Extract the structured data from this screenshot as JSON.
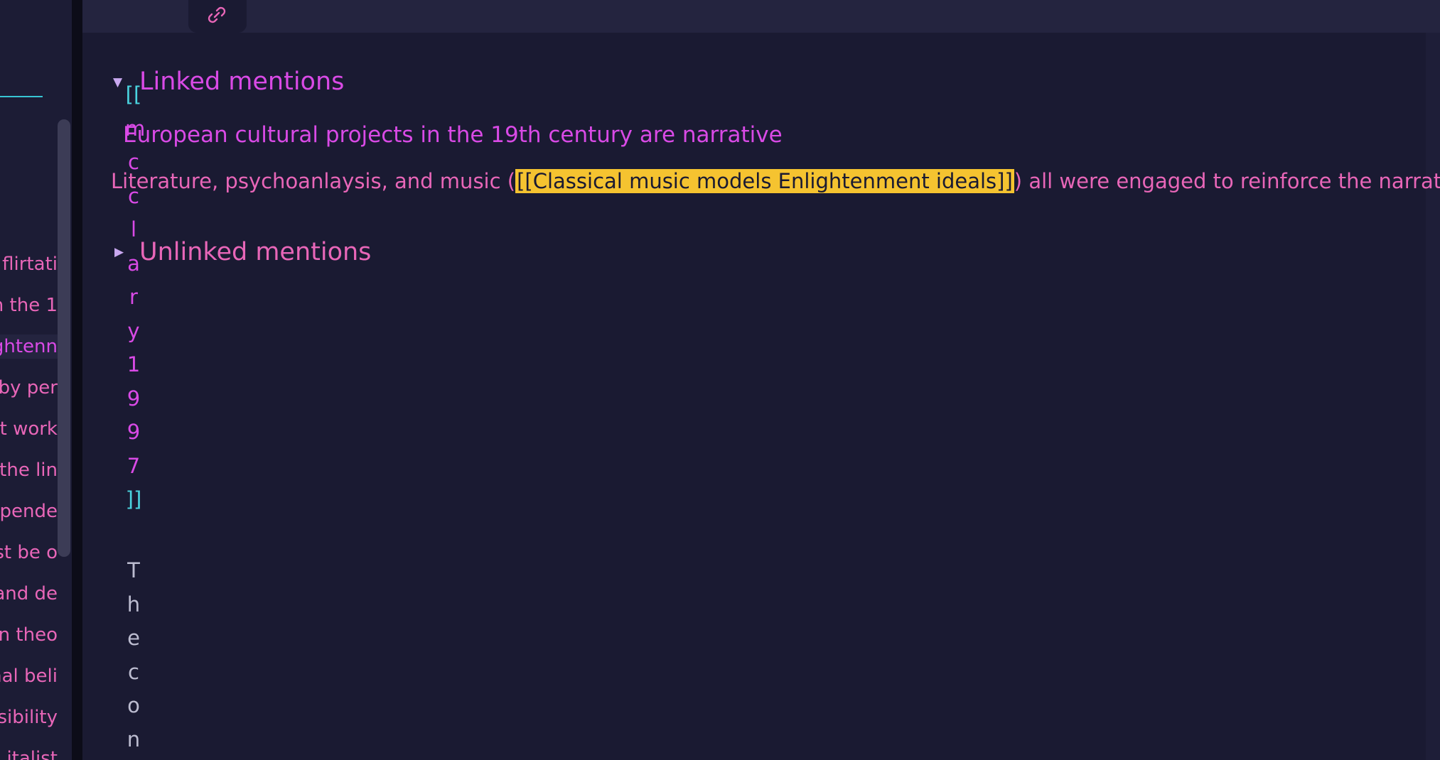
{
  "sidebar": {
    "items": [
      {
        "label": "flirtati"
      },
      {
        "label": "n the 1"
      },
      {
        "label": "ghtenn"
      },
      {
        "label": "by per"
      },
      {
        "label": "t work"
      },
      {
        "label": "the lin"
      },
      {
        "label": "pende"
      },
      {
        "label": "ust be o"
      },
      {
        "label": "and de"
      },
      {
        "label": "n theo"
      },
      {
        "label": "nal beli"
      },
      {
        "label": "sibility"
      },
      {
        "label": "italist"
      }
    ],
    "active_index": 2
  },
  "tab": {
    "icon": "link-icon"
  },
  "backlinks": {
    "linked": {
      "title": "Linked mentions",
      "expanded": true,
      "note_title": "European cultural projects in the 19th century are narrative",
      "mention": {
        "before": "Literature, psychoanlaysis, and music (",
        "link": "[[Classical music models Enlightenment ideals]]",
        "after": ") all were engaged to reinforce the narrative"
      }
    },
    "unlinked": {
      "title": "Unlinked mentions",
      "expanded": false
    }
  },
  "vertical_text": {
    "open_bracket": "[[",
    "chars": [
      "m",
      "c",
      "c",
      "l",
      "a",
      "r",
      "y",
      "1",
      "9",
      "9",
      "7"
    ],
    "close_bracket": "]]",
    "gray_chars": [
      "T",
      "h",
      "e",
      "c",
      "o",
      "n"
    ]
  },
  "colors": {
    "background": "#1a1a32",
    "accent_magenta": "#d94ae6",
    "text_pink": "#e866b8",
    "link_cyan": "#4ad3df",
    "highlight": "#f5c330"
  }
}
